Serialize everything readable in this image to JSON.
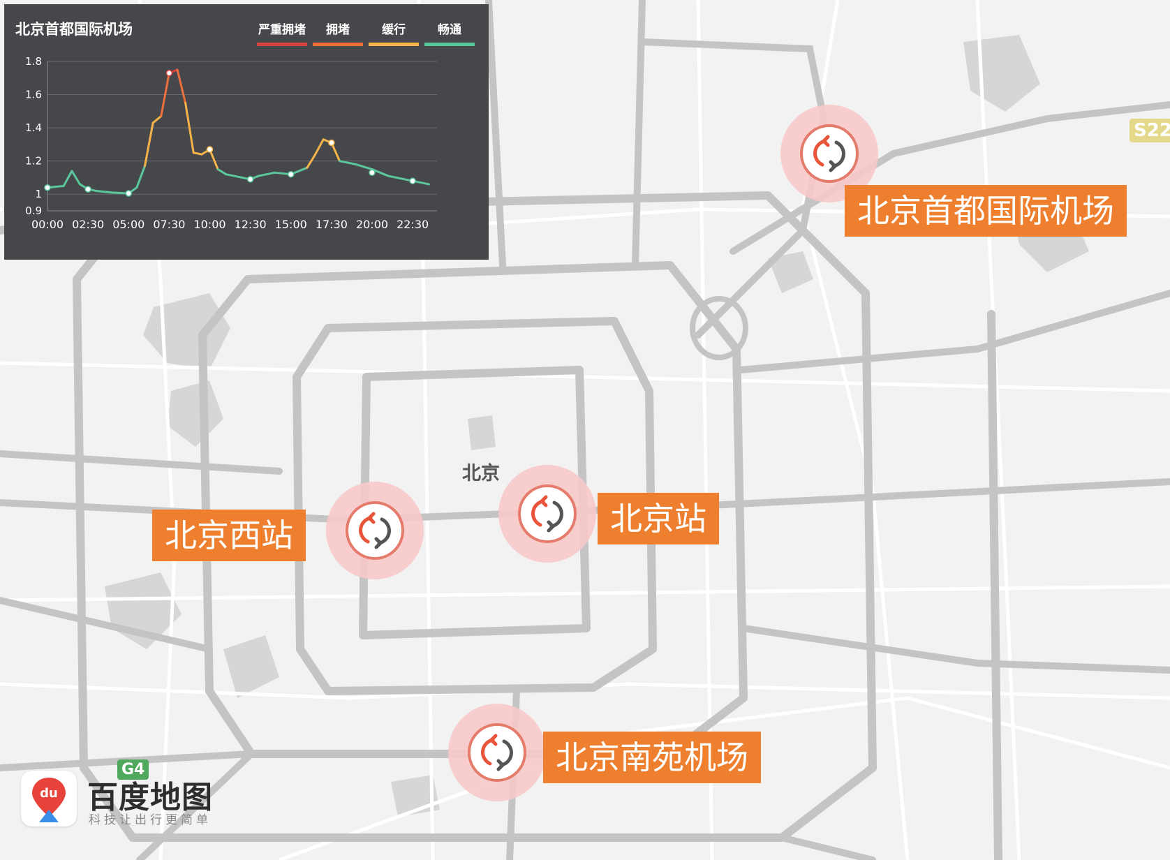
{
  "map": {
    "city_label": "北京",
    "highway_shields": [
      {
        "text": "S22",
        "color": "#c9b84a"
      },
      {
        "text": "G4",
        "color": "#4fa85c"
      }
    ]
  },
  "pois": [
    {
      "label": "北京首都国际机场",
      "marker_icon": "refresh-icon"
    },
    {
      "label": "北京西站",
      "marker_icon": "refresh-icon"
    },
    {
      "label": "北京站",
      "marker_icon": "refresh-icon"
    },
    {
      "label": "北京南苑机场",
      "marker_icon": "refresh-icon"
    }
  ],
  "chart_panel": {
    "title": "北京首都国际机场",
    "legend": [
      {
        "label": "严重拥堵",
        "color": "#d94141"
      },
      {
        "label": "拥堵",
        "color": "#ef6f3c"
      },
      {
        "label": "缓行",
        "color": "#f5b44a"
      },
      {
        "label": "畅通",
        "color": "#5cc79c"
      }
    ]
  },
  "chart_data": {
    "type": "line",
    "title": "北京首都国际机场",
    "x_tick_labels": [
      "00:00",
      "02:30",
      "05:00",
      "07:30",
      "10:00",
      "12:30",
      "15:00",
      "17:30",
      "20:00",
      "22:30"
    ],
    "y_tick_labels": [
      "0.9",
      "1",
      "1.2",
      "1.4",
      "1.6",
      "1.8"
    ],
    "ylim": [
      0.9,
      1.8
    ],
    "grid": true,
    "x_hours": [
      0,
      1,
      1.5,
      2,
      2.5,
      3,
      4,
      5,
      5.5,
      6,
      6.5,
      7,
      7.5,
      8,
      8.5,
      9,
      9.5,
      10,
      10.5,
      11,
      12,
      12.5,
      13,
      14,
      15,
      16,
      16.5,
      17,
      17.5,
      18,
      19,
      20,
      20.5,
      21,
      22,
      22.5,
      23.5
    ],
    "values": [
      1.04,
      1.05,
      1.14,
      1.06,
      1.03,
      1.02,
      1.01,
      1.005,
      1.04,
      1.17,
      1.43,
      1.47,
      1.73,
      1.75,
      1.55,
      1.25,
      1.24,
      1.27,
      1.15,
      1.12,
      1.1,
      1.09,
      1.11,
      1.13,
      1.12,
      1.16,
      1.24,
      1.33,
      1.31,
      1.2,
      1.18,
      1.15,
      1.13,
      1.11,
      1.09,
      1.08,
      1.06
    ],
    "markers": [
      [
        0,
        1.04
      ],
      [
        2.5,
        1.03
      ],
      [
        5,
        1.005
      ],
      [
        7.5,
        1.73
      ],
      [
        10,
        1.27
      ],
      [
        12.5,
        1.09
      ],
      [
        15,
        1.12
      ],
      [
        17.5,
        1.31
      ],
      [
        20,
        1.13
      ],
      [
        22.5,
        1.08
      ]
    ],
    "color_thresholds": {
      "smooth_below": 1.2,
      "slow_below": 1.5,
      "congested_below": 1.7
    }
  },
  "logo": {
    "name": "百度地图",
    "slogan": "科技让出行更简单",
    "badge_text": "du"
  }
}
